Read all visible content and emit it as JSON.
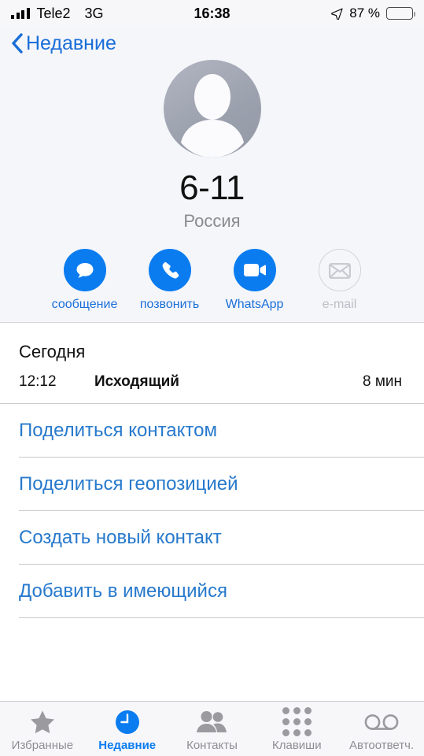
{
  "status_bar": {
    "carrier": "Tele2",
    "network": "3G",
    "time": "16:38",
    "battery_percent": "87 %"
  },
  "nav": {
    "back_label": "Недавние"
  },
  "contact": {
    "name": "6-11",
    "subtitle": "Россия"
  },
  "actions": [
    {
      "label": "сообщение",
      "icon": "message-bubble-icon",
      "disabled": false
    },
    {
      "label": "позвонить",
      "icon": "phone-handset-icon",
      "disabled": false
    },
    {
      "label": "WhatsApp",
      "icon": "video-camera-icon",
      "disabled": false
    },
    {
      "label": "e-mail",
      "icon": "envelope-icon",
      "disabled": true
    }
  ],
  "history": {
    "day_label": "Сегодня",
    "rows": [
      {
        "time": "12:12",
        "type": "Исходящий",
        "duration": "8 мин"
      }
    ]
  },
  "options": [
    "Поделиться контактом",
    "Поделиться геопозицией",
    "Создать новый контакт",
    "Добавить в имеющийся"
  ],
  "tabs": [
    {
      "label": "Избранные",
      "icon": "star-icon",
      "active": false
    },
    {
      "label": "Недавние",
      "icon": "clock-icon",
      "active": true
    },
    {
      "label": "Контакты",
      "icon": "people-icon",
      "active": false
    },
    {
      "label": "Клавиши",
      "icon": "keypad-icon",
      "active": false
    },
    {
      "label": "Автоответч.",
      "icon": "voicemail-icon",
      "active": false
    }
  ],
  "colors": {
    "accent_blue": "#0a7cf0",
    "link_blue": "#2779cc",
    "panel_bg": "#F5F6FA",
    "inactive_grey": "#8e8e93"
  }
}
